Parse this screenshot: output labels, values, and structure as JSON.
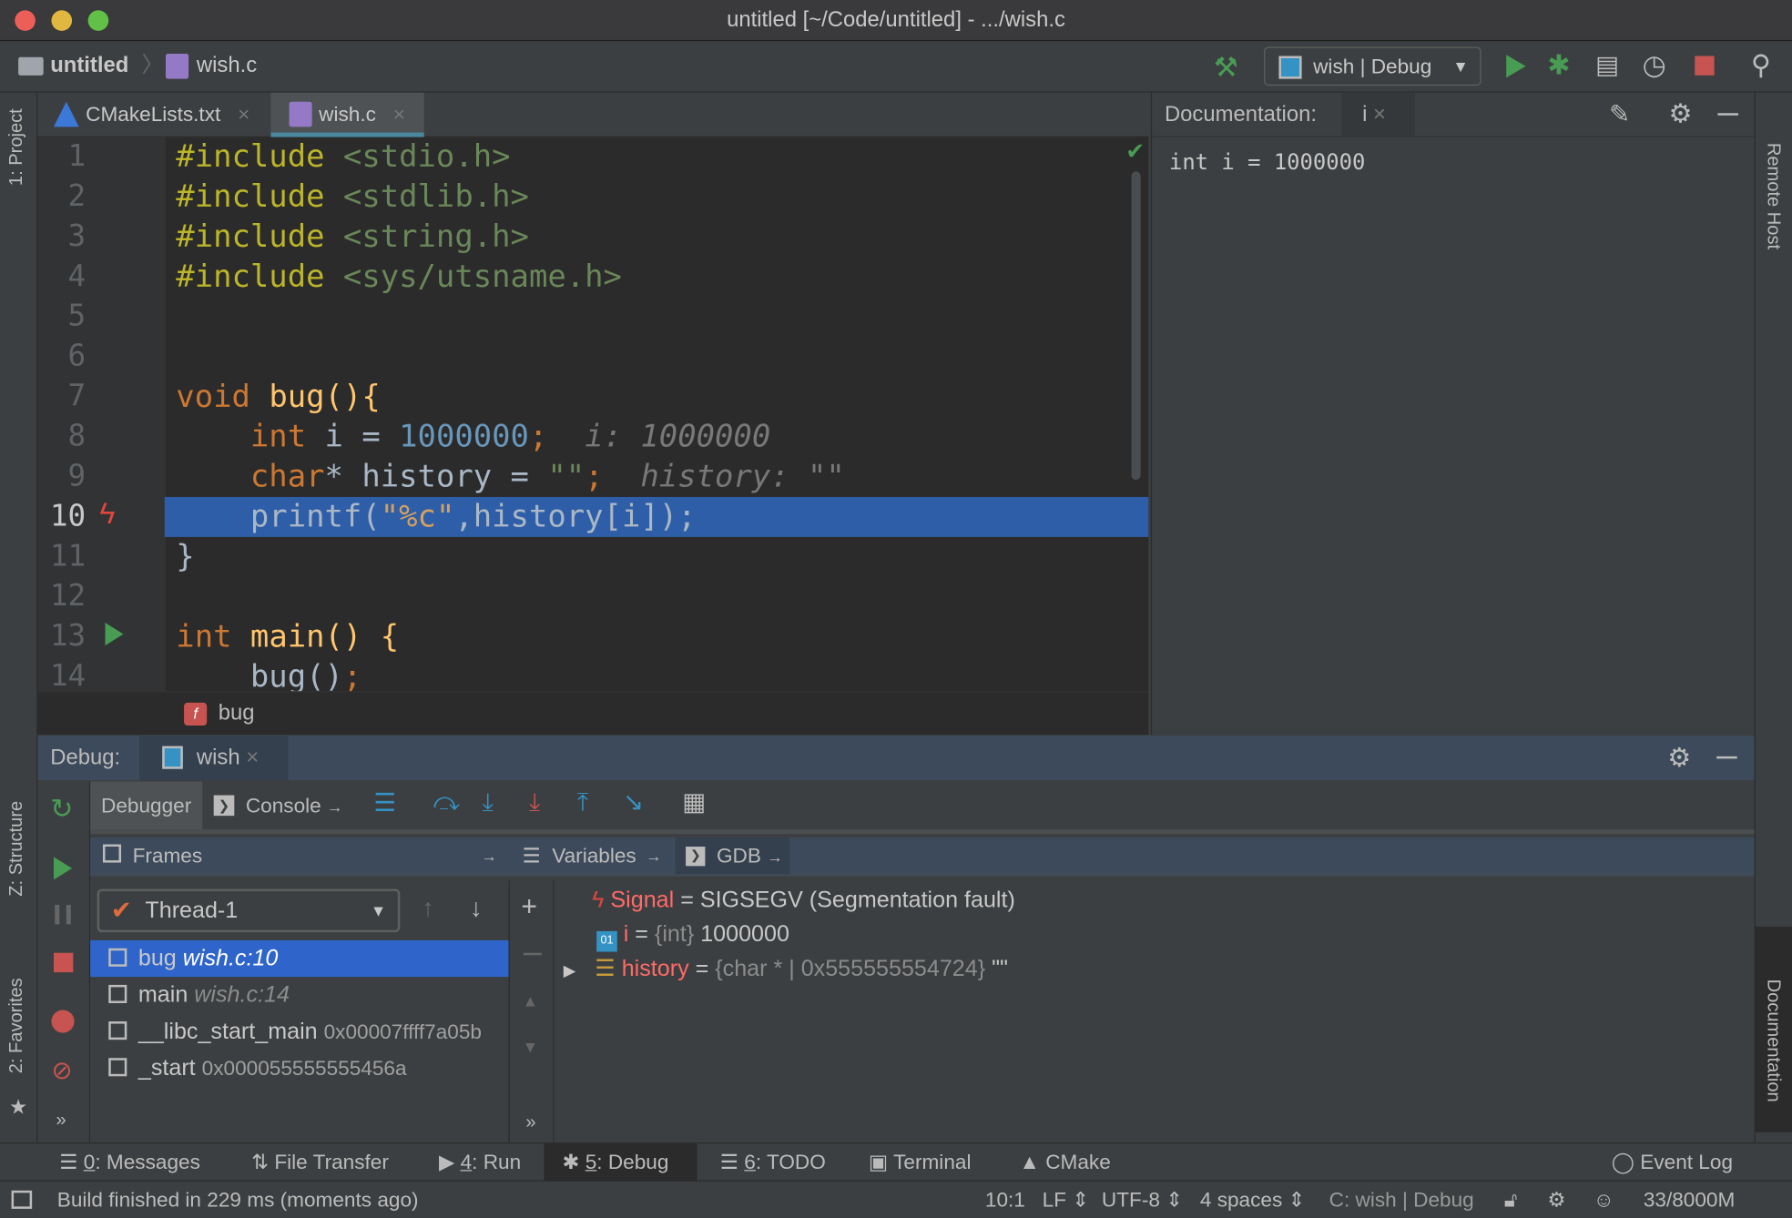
{
  "window": {
    "title": "untitled [~/Code/untitled] - .../wish.c"
  },
  "navbar": {
    "project": "untitled",
    "file": "wish.c",
    "run_config": "wish | Debug"
  },
  "editor_tabs": [
    {
      "label": "CMakeLists.txt",
      "active": false
    },
    {
      "label": "wish.c",
      "active": true
    }
  ],
  "editor": {
    "lines": [
      {
        "n": "1"
      },
      {
        "n": "2"
      },
      {
        "n": "3"
      },
      {
        "n": "4"
      },
      {
        "n": "5"
      },
      {
        "n": "6"
      },
      {
        "n": "7"
      },
      {
        "n": "8"
      },
      {
        "n": "9"
      },
      {
        "n": "10"
      },
      {
        "n": "11"
      },
      {
        "n": "12"
      },
      {
        "n": "13"
      },
      {
        "n": "14"
      }
    ],
    "code": {
      "l1": [
        "#include",
        "<stdio.h>"
      ],
      "l2": [
        "#include",
        "<stdlib.h>"
      ],
      "l3": [
        "#include",
        "<string.h>"
      ],
      "l4": [
        "#include",
        "<sys/utsname.h>"
      ],
      "l7": [
        "void",
        "bug(){"
      ],
      "l8": [
        "int",
        " i = ",
        "1000000",
        ";",
        "i: 1000000"
      ],
      "l9": [
        "char",
        "* history = ",
        "\"\"",
        ";",
        "history: \"\""
      ],
      "l10": [
        "printf(",
        "\"%c\"",
        ",history[i]);"
      ],
      "l11": "}",
      "l13": [
        "int",
        " main() {"
      ],
      "l14": [
        "bug()",
        ";"
      ]
    },
    "current_line": 10,
    "breadcrumb": "bug"
  },
  "documentation": {
    "title": "Documentation:",
    "tab": "i",
    "content": "int i = 1000000"
  },
  "left_strip": {
    "project": "1: Project",
    "structure": "Z: Structure",
    "favorites": "2: Favorites"
  },
  "right_strip": {
    "remote_host": "Remote Host",
    "documentation": "Documentation"
  },
  "debug": {
    "label": "Debug:",
    "session": "wish",
    "tabs": {
      "debugger": "Debugger",
      "console": "Console"
    },
    "frames_title": "Frames",
    "variables_title": "Variables",
    "gdb_title": "GDB",
    "thread": "Thread-1",
    "frames": [
      {
        "name": "bug",
        "loc": "wish.c:10",
        "selected": true
      },
      {
        "name": "main",
        "loc": "wish.c:14"
      },
      {
        "name": "__libc_start_main",
        "addr": "0x00007ffff7a05b"
      },
      {
        "name": "_start",
        "addr": "0x000055555555456a"
      }
    ],
    "variables": [
      {
        "name": "Signal",
        "eq": " = ",
        "value": "SIGSEGV (Segmentation fault)",
        "type": ""
      },
      {
        "name": "i",
        "eq": " = ",
        "type": "{int}",
        "value": " 1000000"
      },
      {
        "name": "history",
        "eq": " = ",
        "type": "{char * | 0x555555554724}",
        "value": " \"\""
      }
    ]
  },
  "bottom_tools": [
    {
      "num": "0",
      "label": ": Messages"
    },
    {
      "num": "",
      "label": "File Transfer"
    },
    {
      "num": "4",
      "label": ": Run"
    },
    {
      "num": "5",
      "label": ": Debug"
    },
    {
      "num": "6",
      "label": ": TODO"
    },
    {
      "num": "",
      "label": "Terminal"
    },
    {
      "num": "",
      "label": "CMake"
    }
  ],
  "event_log": "Event Log",
  "status": {
    "message": "Build finished in 229 ms (moments ago)",
    "position": "10:1",
    "line_sep": "LF",
    "encoding": "UTF-8",
    "indent": "4 spaces",
    "context": "C: wish | Debug",
    "memory": "33/8000M"
  },
  "colors": {
    "keyword": "#cc7832",
    "directive": "#bbb529",
    "string": "#6a8759",
    "number": "#6897bb",
    "current_line": "#2f5ea8",
    "selected_frame": "#2f65ca",
    "run": "#499c54",
    "stop": "#c75450"
  }
}
